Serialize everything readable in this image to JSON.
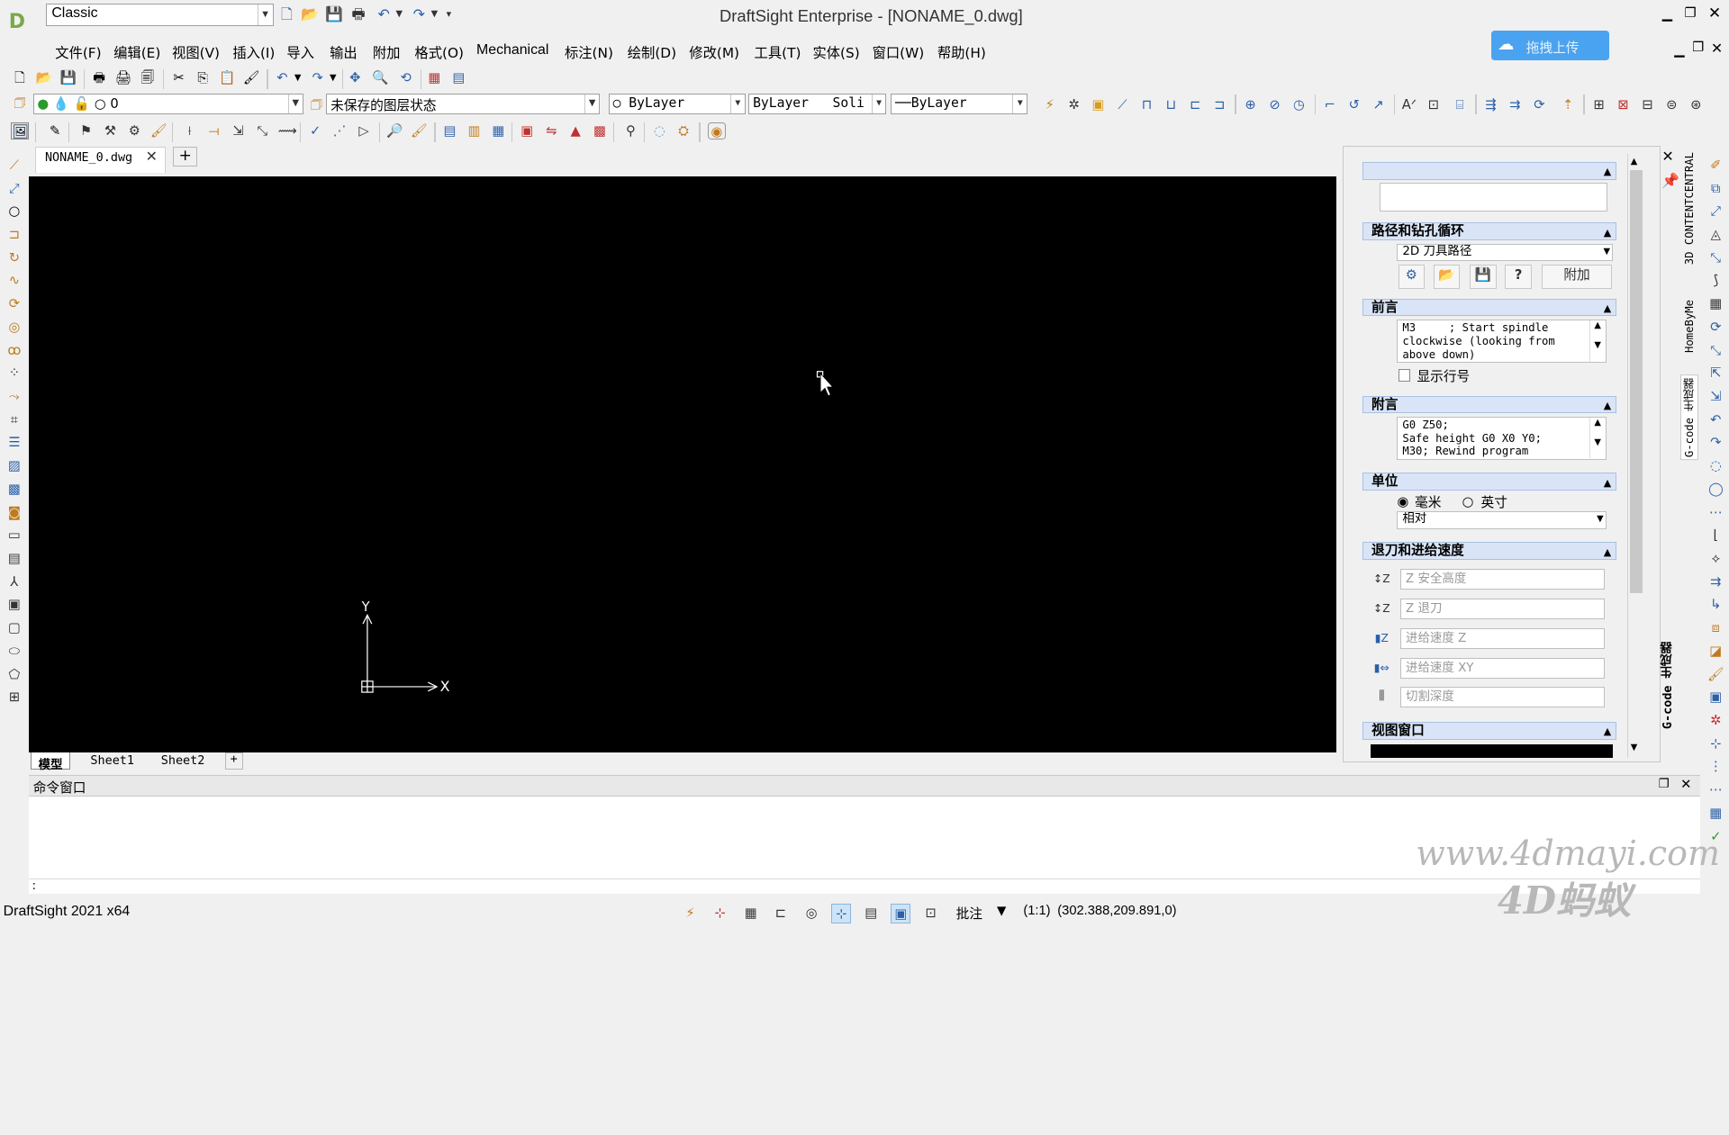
{
  "app": {
    "title": "DraftSight Enterprise - [NONAME_0.dwg]",
    "workspace": "Classic",
    "version_status": "DraftSight 2021 x64"
  },
  "menu": [
    "文件(F)",
    "编辑(E)",
    "视图(V)",
    "插入(I)",
    "导入",
    "输出",
    "附加",
    "格式(O)",
    "Mechanical",
    "标注(N)",
    "绘制(D)",
    "修改(M)",
    "工具(T)",
    "实体(S)",
    "窗口(W)",
    "帮助(H)"
  ],
  "upload_label": "拖拽上传",
  "layer": {
    "current": "0",
    "state": "未保存的图层状态"
  },
  "props": {
    "color": "ByLayer",
    "linetype_a": "ByLayer",
    "linetype_b": "Soli",
    "lineweight": "ByLayer"
  },
  "doc_tab": "NONAME_0.dwg",
  "sheets": [
    "模型",
    "Sheet1",
    "Sheet2"
  ],
  "ucs": {
    "y": "Y",
    "x": "X"
  },
  "panel": {
    "path_section": "路径和钻孔循环",
    "path_type": "2D 刀具路径",
    "append_label": "附加",
    "preamble_title": "前言",
    "preamble_text": "M3     ; Start spindle\nclockwise (looking from\nabove down)",
    "show_line_numbers": "显示行号",
    "postamble_title": "附言",
    "postamble_text": "G0 Z50;\nSafe height G0 X0 Y0;\nM30; Rewind program",
    "units_title": "单位",
    "unit_mm": "毫米",
    "unit_inch": "英寸",
    "coord_mode": "相对",
    "feed_title": "退刀和进给速度",
    "feed_fields": [
      "Z 安全高度",
      "Z 退刀",
      "进给速度 Z",
      "进给速度 XY",
      "切割深度"
    ],
    "viewport_title": "视图窗口",
    "vtab_gcode": "G-code 生成器",
    "vtab_3dcc": "3D CONTENTCENTRAL",
    "vtab_homebyme": "HomeByMe",
    "vtab_gcode2": "G-code 生成器"
  },
  "command": {
    "title": "命令窗口",
    "prompt": ":"
  },
  "status": {
    "annotation": "批注",
    "scale": "(1:1)",
    "coords": "(302.388,209.891,0)"
  },
  "watermark": {
    "line1": "www.4dmayi.com",
    "line2": "4D蚂蚁"
  }
}
